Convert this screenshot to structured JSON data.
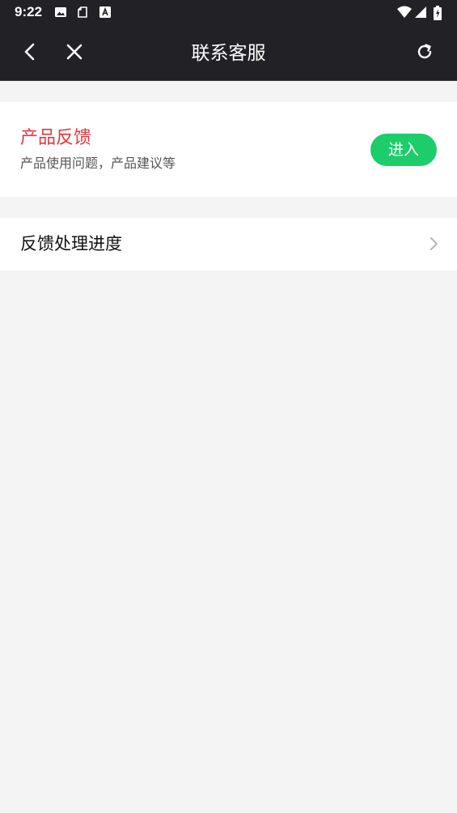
{
  "status_bar": {
    "time": "9:22",
    "icons": [
      "image-icon",
      "clipboard-icon",
      "a-box-icon",
      "wifi-icon",
      "cell-signal-icon",
      "battery-charging-icon"
    ]
  },
  "nav": {
    "title": "联系客服",
    "back_icon": "back-arrow-icon",
    "close_icon": "close-icon",
    "refresh_icon": "refresh-icon"
  },
  "feedback": {
    "title": "产品反馈",
    "subtitle": "产品使用问题，产品建议等",
    "button_label": "进入"
  },
  "progress": {
    "label": "反馈处理进度"
  },
  "colors": {
    "bar_bg": "#222226",
    "accent_red": "#e0383e",
    "accent_green": "#1dcd6b",
    "page_bg": "#f4f4f4"
  }
}
